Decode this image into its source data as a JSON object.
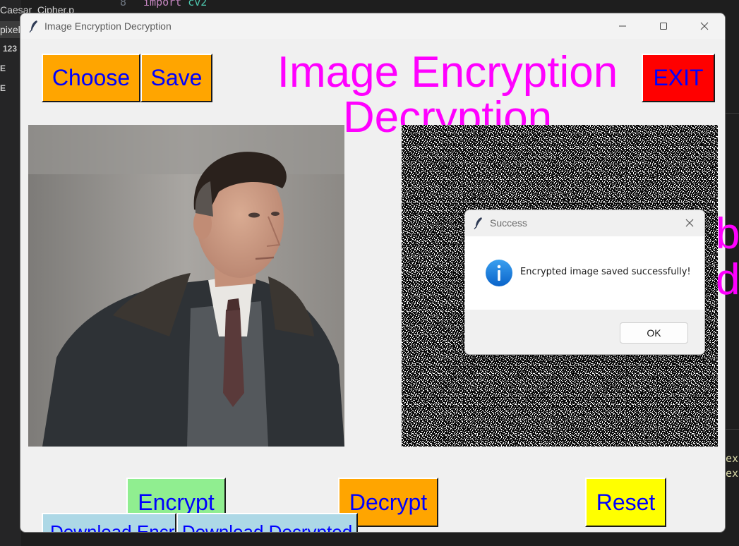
{
  "ide": {
    "tab1": "Caesar_Cipher.p",
    "tab2": "pixel",
    "row1": "123",
    "row2": "E",
    "row3": "E",
    "line_number": "8",
    "code_keyword": "import",
    "code_module": "cv2",
    "right_line1": "ex",
    "right_line2": "ex"
  },
  "window": {
    "title": "Image Encryption Decryption"
  },
  "toolbar": {
    "choose_label": "Choose",
    "save_label": "Save",
    "exit_label": "EXIT"
  },
  "app_title": "Image Encryption Decryption",
  "actions": {
    "encrypt_label": "Encrypt",
    "decrypt_label": "Decrypt",
    "reset_label": "Reset",
    "download_encrypted_label": "Download Encrypted",
    "download_decrypted_label": "Download Decrypted"
  },
  "dialog": {
    "title": "Success",
    "message": "Encrypted image saved successfully!",
    "ok_label": "OK",
    "icon": "info-icon"
  },
  "colors": {
    "title": "#ff00ff",
    "button_text": "#0000ff",
    "choose_bg": "#ffa500",
    "exit_bg": "#ff0000",
    "encrypt_bg": "#90ee90",
    "reset_bg": "#ffff00",
    "download_bg": "#add8e6"
  }
}
